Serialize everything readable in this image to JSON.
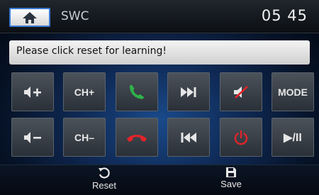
{
  "header": {
    "home_icon": "home-icon",
    "title": "SWC",
    "clock": "05 45"
  },
  "message": "Please click reset for learning!",
  "keys": {
    "vol_up": {
      "icon": "volume-up-icon"
    },
    "ch_up": {
      "label": "CH+"
    },
    "call": {
      "icon": "phone-answer-icon",
      "color": "#2fb34a"
    },
    "next": {
      "icon": "skip-next-icon"
    },
    "mute": {
      "icon": "mute-icon"
    },
    "mode": {
      "label": "MODE"
    },
    "vol_down": {
      "icon": "volume-down-icon"
    },
    "ch_down": {
      "label": "CH–"
    },
    "hangup": {
      "icon": "phone-hangup-icon",
      "color": "#e0242a"
    },
    "prev": {
      "icon": "skip-previous-icon"
    },
    "power": {
      "icon": "power-icon",
      "color": "#e0242a"
    },
    "play_pause": {
      "label": "▶/II"
    }
  },
  "footer": {
    "reset_label": "Reset",
    "save_label": "Save"
  }
}
